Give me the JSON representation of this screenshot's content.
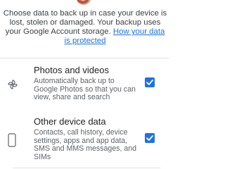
{
  "intro": {
    "text": "Choose data to back up in case your device is lost, stolen or damaged. Your backup uses your Google Account storage. ",
    "link": "How your data is protected"
  },
  "options": [
    {
      "icon": "pinwheel-icon",
      "title": "Photos and videos",
      "description": "Automatically back up to Google Photos so that you can view, share and search",
      "checked": true
    },
    {
      "icon": "phone-icon",
      "title": "Other device data",
      "description": "Contacts, call history, device settings, apps and app data, SMS and MMS messages, and SIMs",
      "checked": true
    }
  ],
  "colors": {
    "accent": "#1a73e8",
    "divider": "#e3e3e3"
  }
}
